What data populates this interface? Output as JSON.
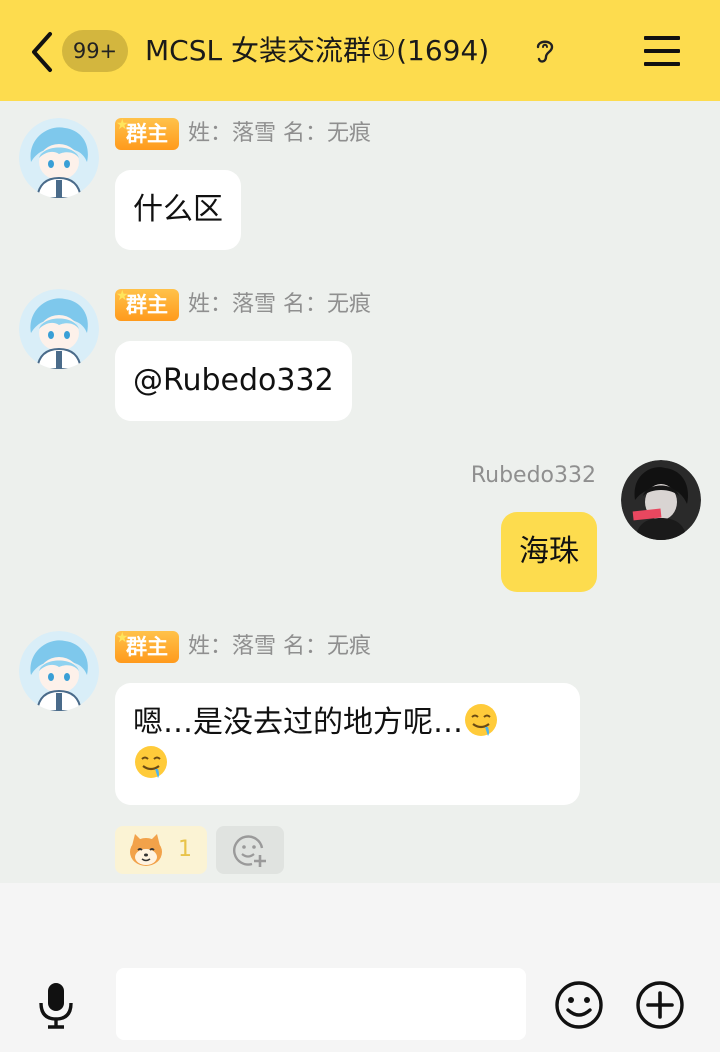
{
  "header": {
    "unread_badge": "99+",
    "title": "MCSL 女装交流群①(1694)",
    "icons": [
      "back-arrow-icon",
      "ear-icon",
      "menu-icon"
    ]
  },
  "messages": [
    {
      "role": "群主",
      "sender": "姓：落雪 名：无痕",
      "text": "什么区"
    },
    {
      "role": "群主",
      "sender": "姓：落雪 名：无痕",
      "text": "@Rubedo332"
    },
    {
      "sender": "Rubedo332",
      "text": "海珠",
      "self": true
    },
    {
      "role": "群主",
      "sender": "姓：落雪 名：无痕",
      "text": "嗯…是没去过的地方呢…"
    }
  ],
  "reactions": [
    {
      "icon": "shiba-dog-emoji-icon",
      "count": "1"
    },
    {
      "icon": "add-reaction-icon"
    }
  ],
  "input": {
    "placeholder": "",
    "icons": [
      "microphone-icon",
      "emoji-smile-icon",
      "plus-circle-icon"
    ]
  },
  "colors": {
    "header_bg": "#fddc4e",
    "self_bubble": "#fddc4e",
    "chat_bg": "#edf0ed",
    "role_badge": "#ff9a1c"
  }
}
